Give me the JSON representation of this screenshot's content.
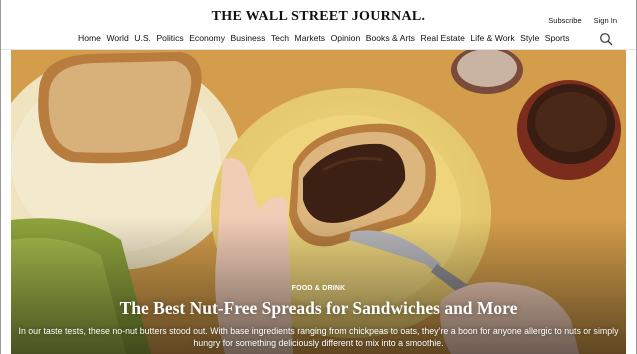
{
  "header": {
    "masthead": "THE WALL STREET JOURNAL.",
    "subscribe_label": "Subscribe",
    "signin_label": "Sign In",
    "search_icon": "search-icon",
    "nav": [
      "Home",
      "World",
      "U.S.",
      "Politics",
      "Economy",
      "Business",
      "Tech",
      "Markets",
      "Opinion",
      "Books & Arts",
      "Real Estate",
      "Life & Work",
      "Style",
      "Sports"
    ]
  },
  "hero": {
    "kicker": "FOOD & DRINK",
    "headline": "The Best Nut-Free Spreads for Sandwiches and More",
    "dek": "In our taste tests, these no-nut butters stood out. With base ingredients ranging from chickpeas to oats, they’re a boon for anyone allergic to nuts or simply hungry for something deliciously different to mix into a smoothie."
  },
  "colors": {
    "table": "#d9a352",
    "plate": "#ecd27a",
    "spread": "#3b2013",
    "text": "#111111"
  }
}
